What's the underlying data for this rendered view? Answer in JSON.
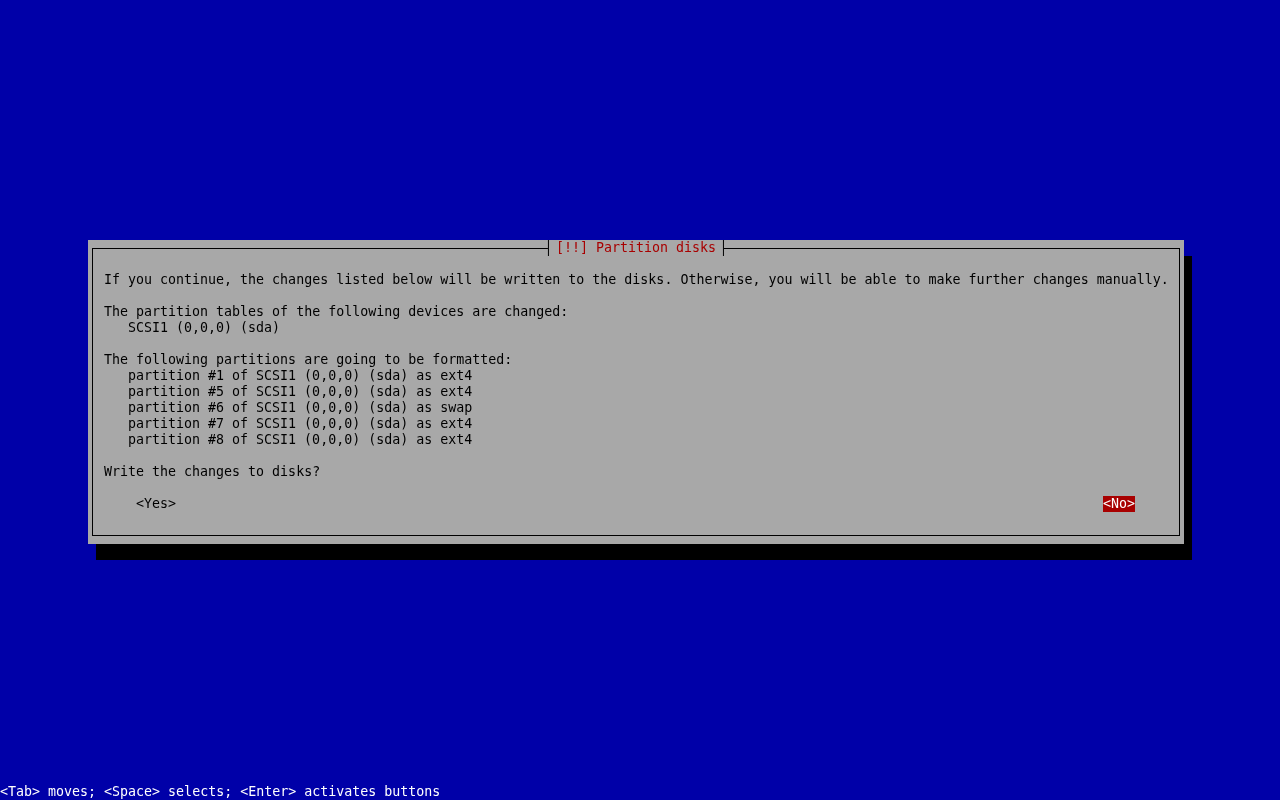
{
  "dialog": {
    "title": "[!!] Partition disks",
    "intro": "If you continue, the changes listed below will be written to the disks. Otherwise, you will be able to make further changes manually.",
    "sections": [
      {
        "heading": "The partition tables of the following devices are changed:",
        "items": [
          "SCSI1 (0,0,0) (sda)"
        ]
      },
      {
        "heading": "The following partitions are going to be formatted:",
        "items": [
          "partition #1 of SCSI1 (0,0,0) (sda) as ext4",
          "partition #5 of SCSI1 (0,0,0) (sda) as ext4",
          "partition #6 of SCSI1 (0,0,0) (sda) as swap",
          "partition #7 of SCSI1 (0,0,0) (sda) as ext4",
          "partition #8 of SCSI1 (0,0,0) (sda) as ext4"
        ]
      }
    ],
    "question": "Write the changes to disks?",
    "buttons": [
      {
        "label": "<Yes>",
        "selected": false
      },
      {
        "label": "<No>",
        "selected": true
      }
    ]
  },
  "status_bar": "<Tab> moves; <Space> selects; <Enter> activates buttons"
}
